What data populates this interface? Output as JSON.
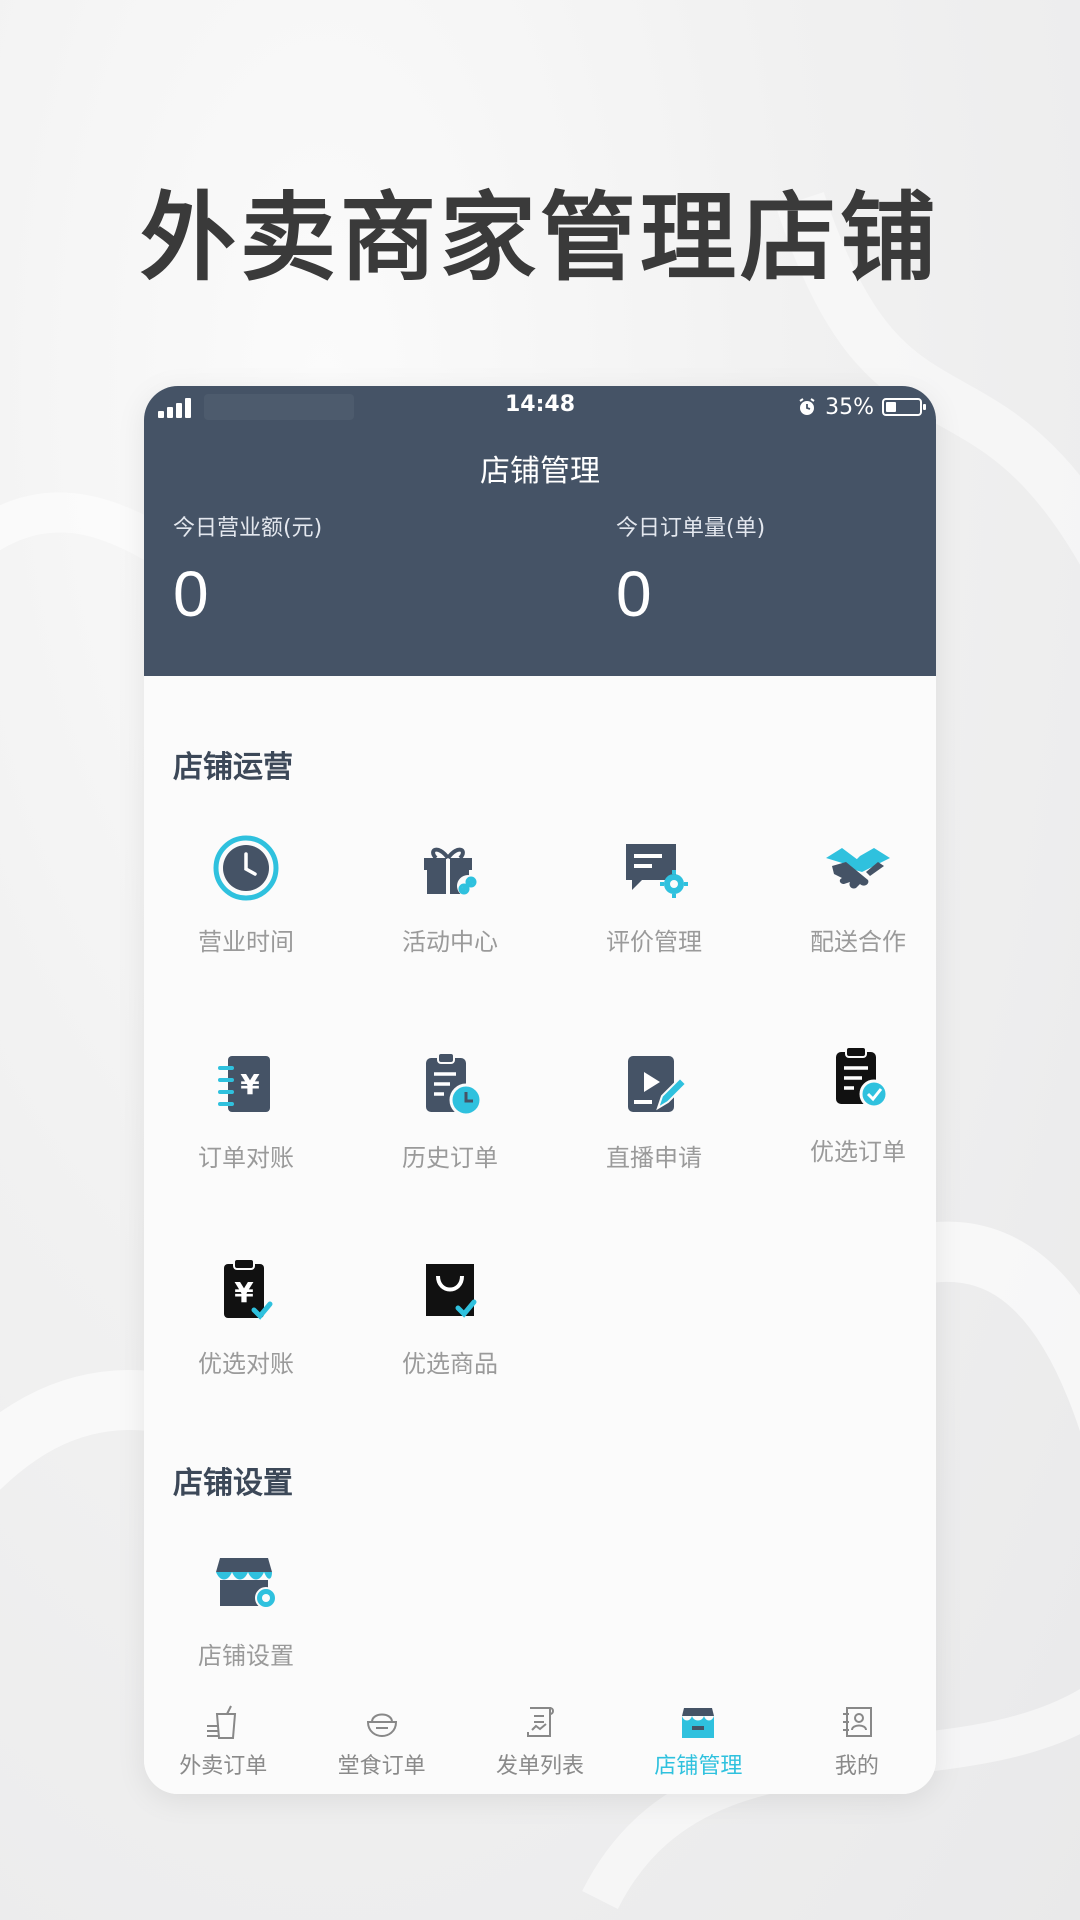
{
  "headline": "外卖商家管理店铺",
  "status_bar": {
    "time": "14:48",
    "battery": "35%"
  },
  "header": {
    "title": "店铺管理",
    "stats": [
      {
        "label": "今日营业额(元)",
        "value": "0"
      },
      {
        "label": "今日订单量(单)",
        "value": "0"
      }
    ]
  },
  "sections": [
    {
      "title": "店铺运营",
      "items": [
        {
          "label": "营业时间",
          "icon": "clock-icon"
        },
        {
          "label": "活动中心",
          "icon": "gift-icon"
        },
        {
          "label": "评价管理",
          "icon": "review-gear-icon"
        },
        {
          "label": "配送合作",
          "icon": "handshake-icon"
        },
        {
          "label": "订单对账",
          "icon": "ledger-yen-icon"
        },
        {
          "label": "历史订单",
          "icon": "history-clipboard-icon"
        },
        {
          "label": "直播申请",
          "icon": "live-edit-icon"
        },
        {
          "label": "优选订单",
          "icon": "clipboard-check-icon"
        },
        {
          "label": "优选对账",
          "icon": "clipboard-yen-icon"
        },
        {
          "label": "优选商品",
          "icon": "shopping-bag-icon"
        }
      ]
    },
    {
      "title": "店铺设置",
      "items": [
        {
          "label": "店铺设置",
          "icon": "store-gear-icon"
        }
      ]
    }
  ],
  "tabbar": {
    "active_index": 3,
    "tabs": [
      {
        "label": "外卖订单",
        "icon": "takeout-cup-icon"
      },
      {
        "label": "堂食订单",
        "icon": "bowl-icon"
      },
      {
        "label": "发单列表",
        "icon": "document-list-icon"
      },
      {
        "label": "店铺管理",
        "icon": "store-icon"
      },
      {
        "label": "我的",
        "icon": "profile-card-icon"
      }
    ]
  },
  "colors": {
    "header_bg": "#455366",
    "accent": "#2fc1de",
    "icon_dark": "#455366",
    "label_gray": "#9a9a9a"
  }
}
